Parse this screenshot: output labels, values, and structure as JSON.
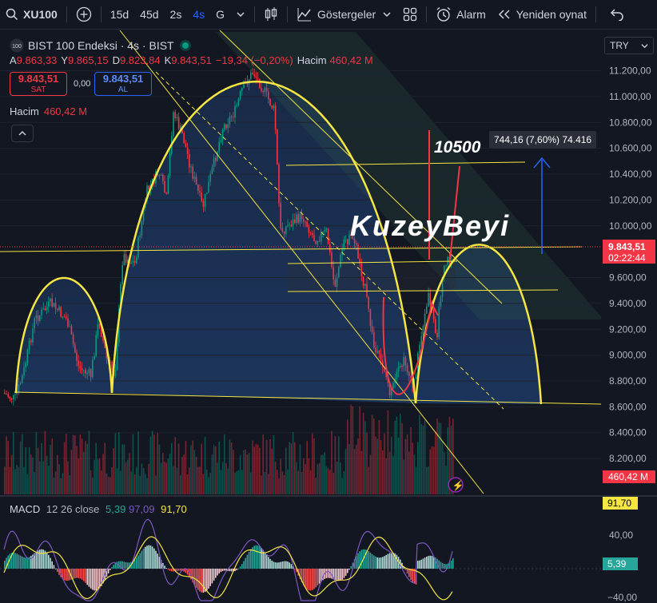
{
  "toolbar": {
    "symbol": "XU100",
    "intervals": [
      "15d",
      "45d",
      "2s",
      "4s",
      "G"
    ],
    "active_interval": "4s",
    "indicators_label": "Göstergeler",
    "alarm_label": "Alarm",
    "replay_label": "Yeniden oynat"
  },
  "legend": {
    "badge": "100",
    "title": "BIST 100 Endeksi · 4s · BIST",
    "ohlc": [
      {
        "k": "A",
        "v": "9.863,33"
      },
      {
        "k": "Y",
        "v": "9.865,15"
      },
      {
        "k": "D",
        "v": "9.823,84"
      },
      {
        "k": "K",
        "v": "9.843,51"
      }
    ],
    "change": "−19,34 (−0,20%)",
    "volume_label": "Hacim",
    "volume_value": "460,42 M",
    "sell_price": "9.843,51",
    "sell_label": "SAT",
    "spread": "0,00",
    "buy_price": "9.843,51",
    "buy_label": "AL"
  },
  "volume_legend": {
    "label": "Hacim",
    "value": "460,42 M"
  },
  "currency": "TRY",
  "price_axis": {
    "ticks": [
      "11.200,00",
      "11.000,00",
      "10.800,00",
      "10.600,00",
      "10.400,00",
      "10.200,00",
      "10.000,00",
      "9.600,00",
      "9.400,00",
      "9.200,00",
      "9.000,00",
      "8.800,00",
      "8.600,00",
      "8.400,00",
      "8.200,00"
    ],
    "last_price": "9.843,51",
    "countdown": "02:22:44",
    "volume_tag": "460,42 M"
  },
  "macd_axis": {
    "ticks": [
      "40,00",
      "−40,00"
    ],
    "signal_tag": "91,70",
    "hist_tag": "5,39"
  },
  "macd_legend": {
    "name": "MACD",
    "params": "12 26 close",
    "v1": "5,39",
    "v2": "97,09",
    "v3": "91,70"
  },
  "annotations": {
    "target_text": "10500",
    "measure_text": "744,16 (7,60%) 74.416",
    "watermark": "KuzeyBeyi"
  },
  "colors": {
    "background": "#131722",
    "up": "#089981",
    "down": "#f23645",
    "drawing_yellow": "#f5e642",
    "accent_blue": "#2962ff"
  },
  "icons": [
    "search-icon",
    "plus-icon",
    "chevron-down-icon",
    "candles-icon",
    "indicators-icon",
    "grid-icon",
    "alarm-icon",
    "replay-icon",
    "undo-icon",
    "lightning-icon"
  ]
}
